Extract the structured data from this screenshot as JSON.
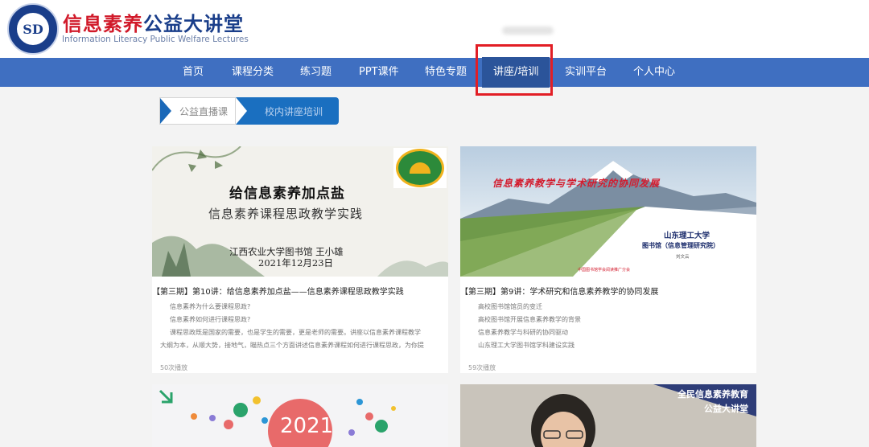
{
  "brand": {
    "title_part1": "信息素养",
    "title_part2": "公益大讲堂",
    "subtitle": "Information Literacy Public Welfare Lectures",
    "logo_icon": "circular-seal-logo",
    "logo_glyph": "SD",
    "colors": {
      "red": "#d11a2a",
      "blue": "#1a3e8a"
    }
  },
  "nav": {
    "items": [
      {
        "label": "首页"
      },
      {
        "label": "课程分类"
      },
      {
        "label": "练习题"
      },
      {
        "label": "PPT课件"
      },
      {
        "label": "特色专题"
      },
      {
        "label": "讲座/培训"
      },
      {
        "label": "实训平台"
      },
      {
        "label": "个人中心"
      }
    ],
    "active": "讲座/培训",
    "color": "#3f6fc1"
  },
  "subtabs": [
    {
      "label": "公益直播课"
    },
    {
      "label": "校内讲座培训"
    }
  ],
  "cards": [
    {
      "title": "【第三期】第10讲：给信息素养加点盐——信息素养课程思政教学实践",
      "lines": [
        "信息素养为什么要课程思政?",
        "信息素养如何进行课程思政?"
      ],
      "para_line1": "课程思政既是国家的需要，也是学生的需要，更是老师的需要。讲座以信息素养课程教学",
      "para_line2": "大纲为本，从顺大势，接地气，瞄热点三个方面讲述信息素养课程如何进行课程思政，为你提",
      "views": "50次播放",
      "thumb": {
        "title": "给信息素养加点盐",
        "subtitle": "信息素养课程思政教学实践",
        "speaker": "江西农业大学图书馆 王小雄",
        "date": "2021年12月23日"
      }
    },
    {
      "title": "【第三期】第9讲：学术研究和信息素养教学的协同发展",
      "lines": [
        "高校图书馆馆员的变迁",
        "高校图书馆开展信息素养教学的背景",
        "信息素养教学与科研的协同驱动",
        "山东理工大学图书馆学科建设实践"
      ],
      "views": "59次播放",
      "thumb": {
        "title": "信息素养教学与学术研究的协同发展",
        "school": "山东理工大学",
        "library": "图书馆（信息管理研究院）",
        "author": "刘文云",
        "footer": "中国图书馆学会阅读推广分会"
      }
    },
    {
      "thumb": {
        "year": "2021"
      }
    },
    {
      "thumb": {
        "line1": "全民信息素养教育",
        "line2": "公益大讲堂"
      }
    }
  ]
}
